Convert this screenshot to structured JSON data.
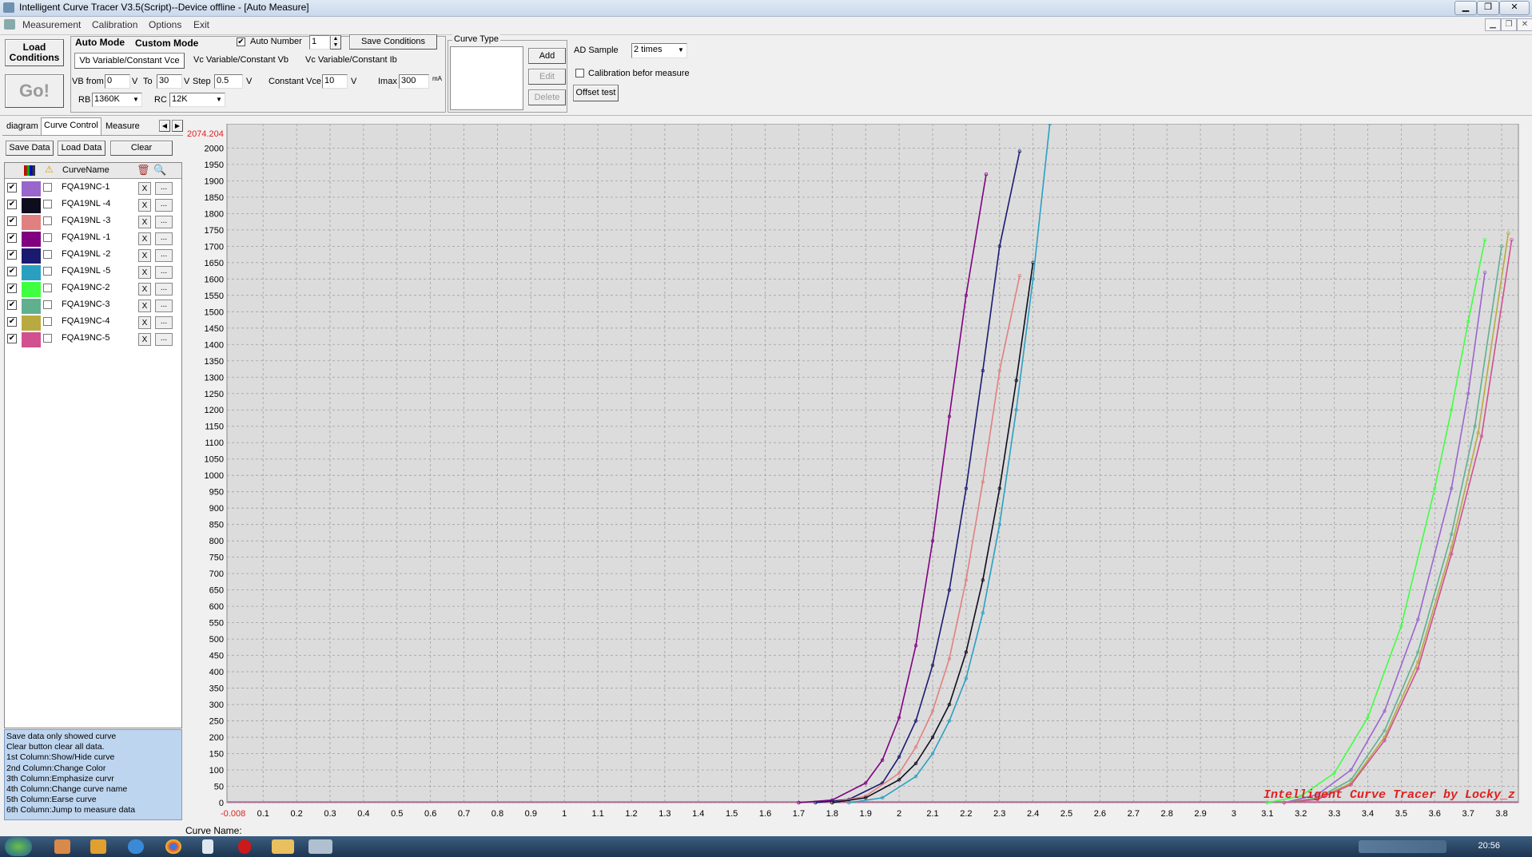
{
  "window": {
    "title": "Intelligent Curve Tracer V3.5(Script)--Device offline - [Auto Measure]"
  },
  "menu": [
    "Measurement",
    "Calibration",
    "Options",
    "Exit"
  ],
  "toolbar": {
    "load_conditions": "Load\nConditions",
    "go": "Go!",
    "auto_mode": "Auto Mode",
    "custom_mode": "Custom Mode",
    "auto_number_label": "Auto Number",
    "auto_number_value": "1",
    "save_conditions": "Save Conditions",
    "mode_tabs": [
      "Vb Variable/Constant Vce",
      "Vc Variable/Constant Vb",
      "Vc Variable/Constant Ib"
    ],
    "vb_from_label": "VB from",
    "vb_from_value": "0",
    "v_unit": "V",
    "to_label": "To",
    "to_value": "30",
    "step_label": "Step",
    "step_value": "0.5",
    "constant_vce_label": "Constant Vce",
    "constant_vce_value": "10",
    "imax_label": "Imax",
    "imax_value": "300",
    "imax_unit": "mA",
    "rb_label": "RB",
    "rb_value": "1360K",
    "rc_label": "RC",
    "rc_value": "12K",
    "curve_type_label": "Curve Type",
    "add": "Add",
    "edit": "Edit",
    "delete": "Delete",
    "ad_sample_label": "AD Sample",
    "ad_sample_value": "2 times",
    "calibration_label": "Calibration befor measure",
    "offset_test": "Offset test"
  },
  "left_tabs": [
    "diagram",
    "Curve Control",
    "Measure Data"
  ],
  "left_buttons": {
    "save": "Save Data",
    "load": "Load Data",
    "clear": "Clear"
  },
  "curve_table": {
    "header": "CurveName",
    "rows": [
      {
        "name": "FQA19NC-1",
        "color": "#9966cc"
      },
      {
        "name": "FQA19NL -4",
        "color": "#0d0d1e"
      },
      {
        "name": "FQA19NL -3",
        "color": "#e08080"
      },
      {
        "name": "FQA19NL -1",
        "color": "#800080"
      },
      {
        "name": "FQA19NL -2",
        "color": "#1a1a70"
      },
      {
        "name": "FQA19NL -5",
        "color": "#2aa0c0"
      },
      {
        "name": "FQA19NC-2",
        "color": "#40ff40"
      },
      {
        "name": "FQA19NC-3",
        "color": "#60b090"
      },
      {
        "name": "FQA19NC-4",
        "color": "#b8aa40"
      },
      {
        "name": "FQA19NC-5",
        "color": "#d05090"
      }
    ],
    "x_label": "X",
    "more_label": "..."
  },
  "help_lines": [
    "  Save data only showed curve",
    "   Clear button clear all data.",
    "1st Column:Show/Hide curve",
    "2nd Column:Change Color",
    "3th Column:Emphasize curvr",
    "4th Column:Change curve name",
    "5th Column:Earse curve",
    "6th Column:Jump to measure data"
  ],
  "status": {
    "curve_name_label": "Curve Name:"
  },
  "clock": "20:56",
  "chart_data": {
    "type": "line",
    "xlim": [
      -0.008,
      3.85
    ],
    "ylim": [
      0,
      2074.204
    ],
    "ymax_label": "2074.204",
    "xmin_label": "-0.008",
    "x_ticks": [
      0.1,
      0.2,
      0.3,
      0.4,
      0.5,
      0.6,
      0.7,
      0.8,
      0.9,
      1,
      1.1,
      1.2,
      1.3,
      1.4,
      1.5,
      1.6,
      1.7,
      1.8,
      1.9,
      2,
      2.1,
      2.2,
      2.3,
      2.4,
      2.5,
      2.6,
      2.7,
      2.8,
      2.9,
      3,
      3.1,
      3.2,
      3.3,
      3.4,
      3.5,
      3.6,
      3.7,
      3.8
    ],
    "y_ticks": [
      0,
      50,
      100,
      150,
      200,
      250,
      300,
      350,
      400,
      450,
      500,
      550,
      600,
      650,
      700,
      750,
      800,
      850,
      900,
      950,
      1000,
      1050,
      1100,
      1150,
      1200,
      1250,
      1300,
      1350,
      1400,
      1450,
      1500,
      1550,
      1600,
      1650,
      1700,
      1750,
      1800,
      1850,
      1900,
      1950,
      2000
    ],
    "grid": true,
    "watermark": "Intelligent Curve Tracer by Locky_z",
    "series": [
      {
        "name": "FQA19NL -1",
        "color": "#800080",
        "x": [
          1.7,
          1.8,
          1.9,
          1.95,
          2.0,
          2.05,
          2.1,
          2.15,
          2.2,
          2.26
        ],
        "y": [
          0,
          8,
          60,
          130,
          260,
          480,
          800,
          1180,
          1550,
          1920
        ]
      },
      {
        "name": "FQA19NL -2",
        "color": "#1a1a70",
        "x": [
          1.75,
          1.85,
          1.95,
          2.0,
          2.05,
          2.1,
          2.15,
          2.2,
          2.25,
          2.3,
          2.36
        ],
        "y": [
          0,
          10,
          60,
          140,
          250,
          420,
          650,
          960,
          1320,
          1700,
          1990
        ]
      },
      {
        "name": "FQA19NL -3",
        "color": "#e08080",
        "x": [
          1.8,
          1.9,
          2.0,
          2.05,
          2.1,
          2.15,
          2.2,
          2.25,
          2.3,
          2.36
        ],
        "y": [
          0,
          20,
          90,
          170,
          280,
          440,
          680,
          980,
          1320,
          1610
        ]
      },
      {
        "name": "FQA19NL -4",
        "color": "#0d0d1e",
        "x": [
          1.8,
          1.9,
          2.0,
          2.05,
          2.1,
          2.15,
          2.2,
          2.25,
          2.3,
          2.35,
          2.4
        ],
        "y": [
          0,
          15,
          70,
          120,
          200,
          300,
          460,
          680,
          960,
          1290,
          1650
        ]
      },
      {
        "name": "FQA19NL -5",
        "color": "#2aa0c0",
        "x": [
          1.85,
          1.95,
          2.05,
          2.1,
          2.15,
          2.2,
          2.25,
          2.3,
          2.35,
          2.4,
          2.45
        ],
        "y": [
          0,
          15,
          80,
          150,
          250,
          380,
          580,
          850,
          1200,
          1600,
          2074
        ]
      },
      {
        "name": "FQA19NC-2",
        "color": "#40ff40",
        "x": [
          3.1,
          3.2,
          3.3,
          3.4,
          3.5,
          3.6,
          3.65,
          3.7,
          3.75
        ],
        "y": [
          0,
          20,
          90,
          260,
          540,
          960,
          1200,
          1470,
          1720
        ]
      },
      {
        "name": "FQA19NC-1",
        "color": "#9966cc",
        "x": [
          3.15,
          3.25,
          3.35,
          3.45,
          3.55,
          3.65,
          3.7,
          3.75
        ],
        "y": [
          0,
          25,
          100,
          280,
          560,
          960,
          1250,
          1620
        ]
      },
      {
        "name": "FQA19NC-3",
        "color": "#60b090",
        "x": [
          3.15,
          3.25,
          3.35,
          3.45,
          3.55,
          3.65,
          3.72,
          3.8
        ],
        "y": [
          0,
          15,
          70,
          220,
          460,
          820,
          1150,
          1700
        ]
      },
      {
        "name": "FQA19NC-4",
        "color": "#b8aa40",
        "x": [
          3.15,
          3.25,
          3.35,
          3.45,
          3.55,
          3.65,
          3.73,
          3.82
        ],
        "y": [
          0,
          12,
          60,
          200,
          430,
          780,
          1130,
          1740
        ]
      },
      {
        "name": "FQA19NC-5",
        "color": "#d05090",
        "x": [
          3.15,
          3.25,
          3.35,
          3.45,
          3.55,
          3.65,
          3.74,
          3.83
        ],
        "y": [
          0,
          10,
          55,
          190,
          410,
          760,
          1120,
          1720
        ]
      }
    ]
  }
}
